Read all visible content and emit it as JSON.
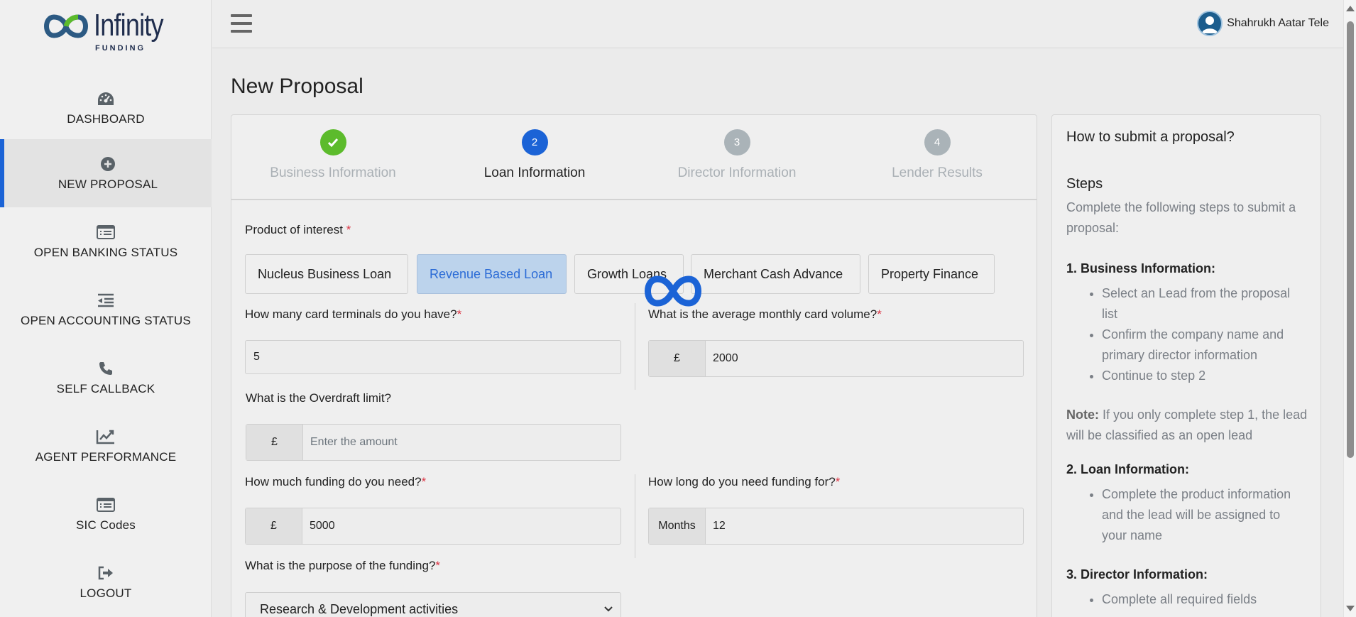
{
  "brand": {
    "name": "Infinity",
    "tagline": "FUNDING"
  },
  "sidebar": {
    "items": [
      {
        "label": "DASHBOARD",
        "icon": "dashboard-gauge-icon"
      },
      {
        "label": "NEW PROPOSAL",
        "icon": "plus-circle-icon",
        "active": true
      },
      {
        "label": "OPEN BANKING STATUS",
        "icon": "list-card-icon"
      },
      {
        "label": "OPEN ACCOUNTING STATUS",
        "icon": "indent-list-icon"
      },
      {
        "label": "SELF CALLBACK",
        "icon": "phone-icon"
      },
      {
        "label": "AGENT PERFORMANCE",
        "icon": "line-chart-icon"
      },
      {
        "label": "SIC Codes",
        "icon": "list-card-icon"
      },
      {
        "label": "LOGOUT",
        "icon": "sign-out-icon"
      }
    ]
  },
  "header": {
    "user_name": "Shahrukh Aatar Tele"
  },
  "page": {
    "title": "New Proposal"
  },
  "wizard": {
    "steps": [
      {
        "number": "",
        "label": "Business Information",
        "state": "done"
      },
      {
        "number": "2",
        "label": "Loan Information",
        "state": "active"
      },
      {
        "number": "3",
        "label": "Director Information",
        "state": "pending"
      },
      {
        "number": "4",
        "label": "Lender Results",
        "state": "pending"
      }
    ]
  },
  "form": {
    "product_label": "Product of interest",
    "required_mark": "*",
    "products": [
      {
        "label": "Nucleus Business Loan",
        "selected": false
      },
      {
        "label": "Revenue Based Loan",
        "selected": true
      },
      {
        "label": "Growth Loans",
        "selected": false
      },
      {
        "label": "Merchant Cash Advance",
        "selected": false
      },
      {
        "label": "Property Finance",
        "selected": false
      }
    ],
    "card_terminals": {
      "label": "How many card terminals do you have?",
      "value": "5"
    },
    "monthly_card_volume": {
      "label": "What is the average monthly card volume?",
      "prefix": "£",
      "value": "2000"
    },
    "overdraft": {
      "label": "What is the Overdraft limit?",
      "prefix": "£",
      "placeholder": "Enter the amount"
    },
    "funding_needed": {
      "label": "How much funding do you need?",
      "prefix": "£",
      "value": "5000"
    },
    "funding_duration": {
      "label": "How long do you need funding for?",
      "prefix": "Months",
      "value": "12"
    },
    "purpose": {
      "label": "What is the purpose of the funding?",
      "value": "Research & Development activities"
    }
  },
  "help": {
    "title": "How to submit a proposal?",
    "steps_heading": "Steps",
    "intro": "Complete the following steps to submit a proposal:",
    "section1": {
      "heading": "1. Business Information:",
      "items": [
        "Select an Lead from the proposal list",
        "Confirm the company name and primary director information",
        "Continue to step 2"
      ]
    },
    "note_key": "Note:",
    "note_text": " If you only complete step 1, the lead will be classified as an open lead",
    "section2": {
      "heading": "2. Loan Information:",
      "items": [
        "Complete the product information and the lead will be assigned to your name"
      ]
    },
    "section3": {
      "heading": "3. Director Information:",
      "items": [
        "Complete all required fields"
      ]
    }
  },
  "colors": {
    "accent": "#1b63d6",
    "success": "#5cbb2c",
    "pending": "#aab3b8",
    "required": "#dc3545"
  }
}
